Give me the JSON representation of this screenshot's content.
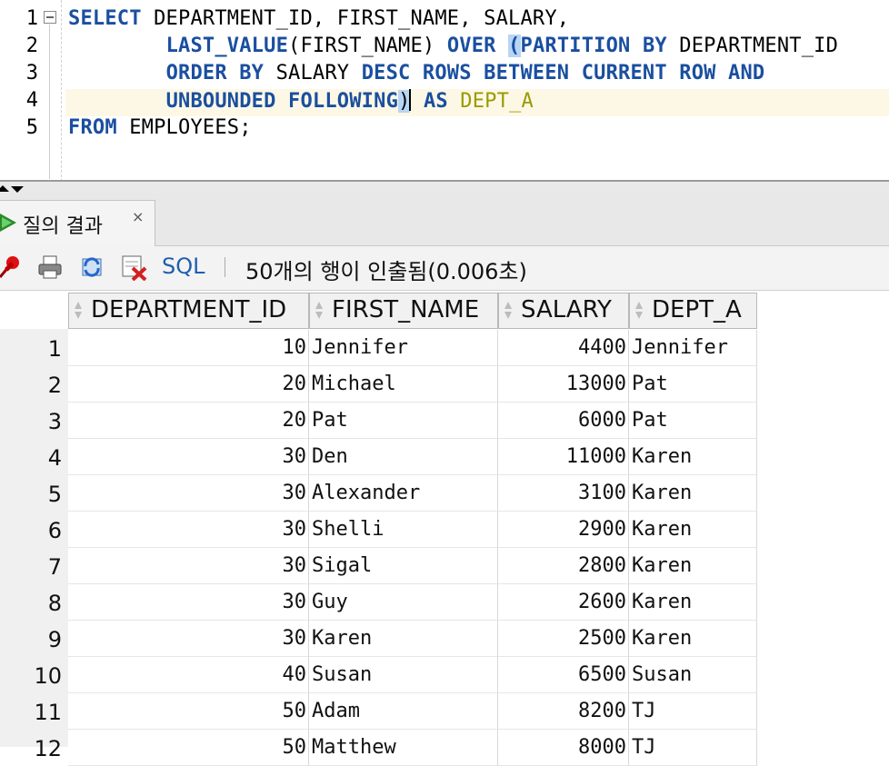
{
  "editor": {
    "line_numbers": [
      "1",
      "2",
      "3",
      "4",
      "5"
    ],
    "lines": [
      [
        {
          "t": "SELECT",
          "c": "kw"
        },
        {
          "t": " DEPARTMENT_ID, FIRST_NAME, SALARY,",
          "c": "id"
        }
      ],
      [
        {
          "t": "        ",
          "c": "id"
        },
        {
          "t": "LAST_VALUE",
          "c": "kw"
        },
        {
          "t": "(FIRST_NAME) ",
          "c": "id"
        },
        {
          "t": "OVER",
          "c": "kw"
        },
        {
          "t": " ",
          "c": "id"
        },
        {
          "t": "(",
          "c": "kw hl"
        },
        {
          "t": "PARTITION BY",
          "c": "kw"
        },
        {
          "t": " DEPARTMENT_ID",
          "c": "id"
        }
      ],
      [
        {
          "t": "        ",
          "c": "id"
        },
        {
          "t": "ORDER BY",
          "c": "kw"
        },
        {
          "t": " SALARY ",
          "c": "id"
        },
        {
          "t": "DESC ROWS BETWEEN CURRENT ROW AND",
          "c": "kw"
        }
      ],
      [
        {
          "t": "        ",
          "c": "id"
        },
        {
          "t": "UNBOUNDED FOLLOWING",
          "c": "kw"
        },
        {
          "t": ")",
          "c": "id hl"
        },
        {
          "t": "|CARET|",
          "c": "caret"
        },
        {
          "t": " ",
          "c": "id"
        },
        {
          "t": "AS",
          "c": "kw"
        },
        {
          "t": " ",
          "c": "id"
        },
        {
          "t": "DEPT_A",
          "c": "alias"
        }
      ],
      [
        {
          "t": "FROM",
          "c": "kw"
        },
        {
          "t": " EMPLOYEES;",
          "c": "id"
        }
      ]
    ]
  },
  "results_tab": {
    "label": "질의 결과",
    "close": "×"
  },
  "toolbar": {
    "sql_label": "SQL",
    "separator": "|",
    "status": "50개의 행이 인출됨(0.006초)"
  },
  "grid": {
    "columns": [
      "DEPARTMENT_ID",
      "FIRST_NAME",
      "SALARY",
      "DEPT_A"
    ],
    "rows": [
      [
        "1",
        "10",
        "Jennifer",
        "4400",
        "Jennifer"
      ],
      [
        "2",
        "20",
        "Michael",
        "13000",
        "Pat"
      ],
      [
        "3",
        "20",
        "Pat",
        "6000",
        "Pat"
      ],
      [
        "4",
        "30",
        "Den",
        "11000",
        "Karen"
      ],
      [
        "5",
        "30",
        "Alexander",
        "3100",
        "Karen"
      ],
      [
        "6",
        "30",
        "Shelli",
        "2900",
        "Karen"
      ],
      [
        "7",
        "30",
        "Sigal",
        "2800",
        "Karen"
      ],
      [
        "8",
        "30",
        "Guy",
        "2600",
        "Karen"
      ],
      [
        "9",
        "30",
        "Karen",
        "2500",
        "Karen"
      ],
      [
        "10",
        "40",
        "Susan",
        "6500",
        "Susan"
      ],
      [
        "11",
        "50",
        "Adam",
        "8200",
        "TJ"
      ],
      [
        "12",
        "50",
        "Matthew",
        "8000",
        "TJ"
      ]
    ]
  },
  "colors": {
    "keyword": "#1a4fa0",
    "alias": "#9a9a00",
    "sql_link": "#1f5fb0"
  }
}
